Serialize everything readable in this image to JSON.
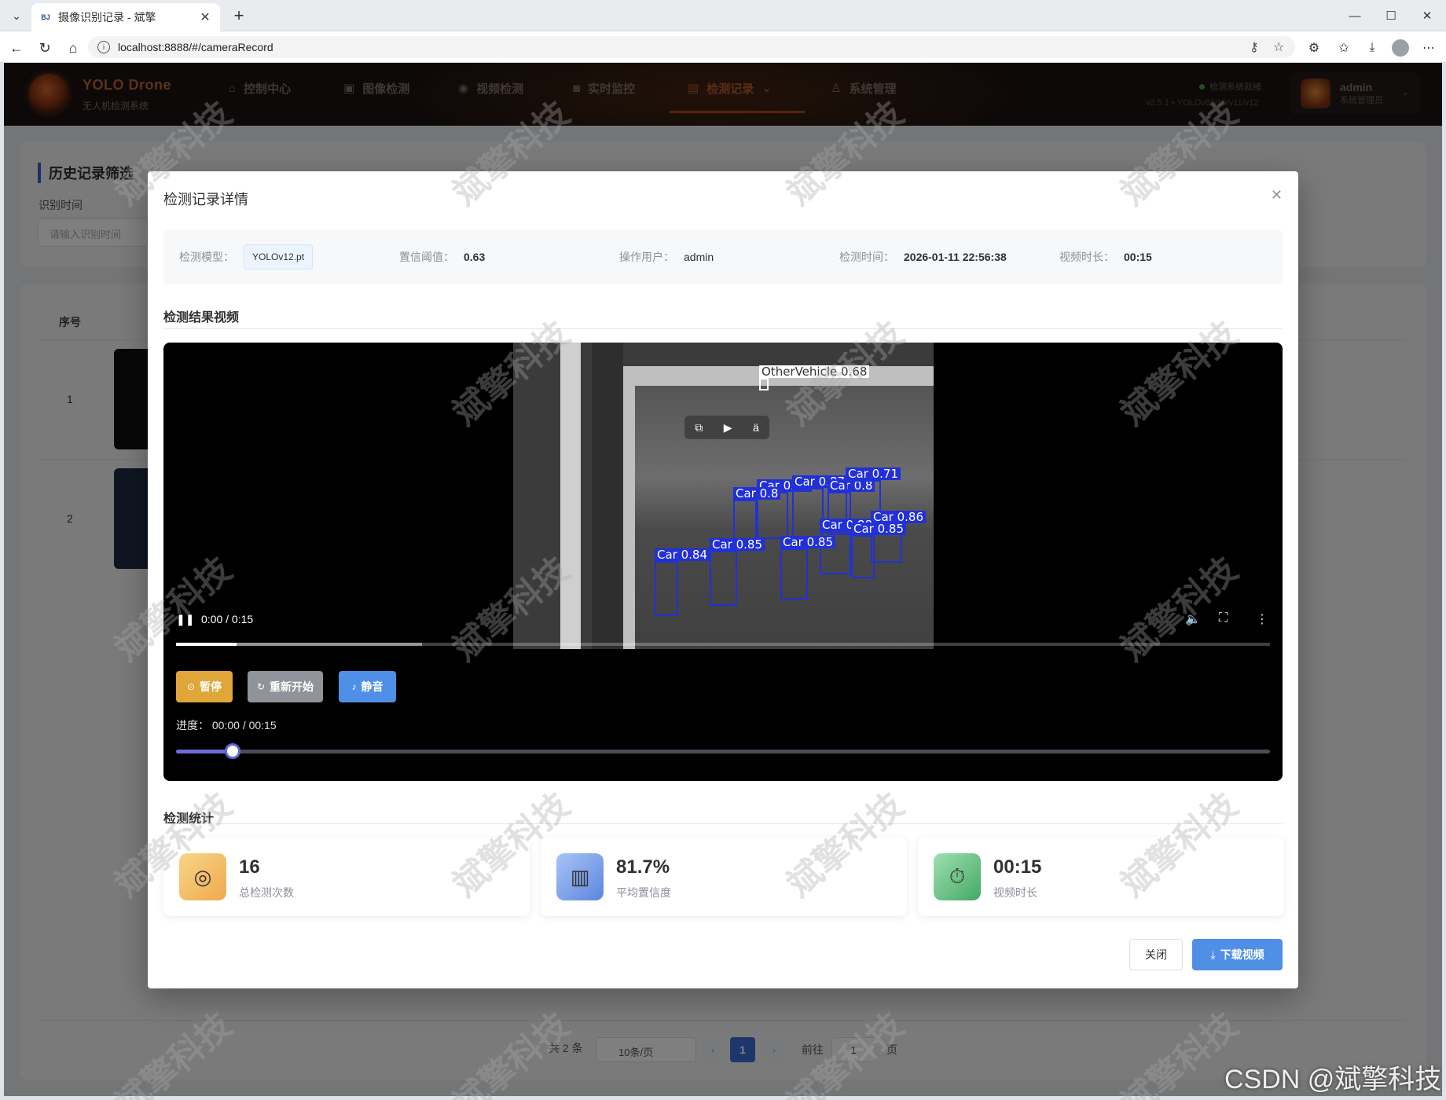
{
  "browser": {
    "tab_title": "摄像识别记录 - 斌擎",
    "favicon_text": "BJ",
    "url": "localhost:8888/#/cameraRecord"
  },
  "header": {
    "app_name": "YOLO Drone",
    "app_sub": "无人机检测系统",
    "nav": [
      {
        "label": "控制中心",
        "icon": "home-icon"
      },
      {
        "label": "图像检测",
        "icon": "image-icon"
      },
      {
        "label": "视频检测",
        "icon": "play-circle-icon"
      },
      {
        "label": "实时监控",
        "icon": "camera-icon"
      },
      {
        "label": "检测记录",
        "icon": "document-icon",
        "active": true
      },
      {
        "label": "系统管理",
        "icon": "user-icon"
      }
    ],
    "status_text": "检测系统就绪",
    "version": "v2.5.1 • YOLOv8/v10/v11/v12",
    "user_name": "admin",
    "user_role": "系统管理员"
  },
  "page": {
    "filter_title": "历史记录筛选",
    "filter_label": "识别时间",
    "filter_placeholder": "请输入识别时间",
    "table_header_seq": "序号",
    "rows": [
      "1",
      "2"
    ],
    "pagination": {
      "total": "共 2 条",
      "page_size": "10条/页",
      "current": "1",
      "goto_prefix": "前往",
      "goto_value": "1",
      "goto_suffix": "页"
    }
  },
  "modal": {
    "title": "检测记录详情",
    "info": {
      "model_label": "检测模型：",
      "model_value": "YOLOv12.pt",
      "conf_label": "置信阈值：",
      "conf_value": "0.63",
      "user_label": "操作用户：",
      "user_value": "admin",
      "time_label": "检测时间：",
      "time_value": "2026-01-11 22:56:38",
      "duration_label": "视频时长：",
      "duration_value": "00:15"
    },
    "video_section_title": "检测结果视频",
    "video": {
      "time_display": "0:00 / 0:15",
      "buffered_fraction": 0.225,
      "played_fraction": 0.055,
      "detections": [
        {
          "label": "OtherVehicle 0.68"
        },
        {
          "label": "Car 0.85"
        },
        {
          "label": "Car 0.87"
        },
        {
          "label": "Car 0.8"
        },
        {
          "label": "Car 0.8"
        },
        {
          "label": "Car 0.71"
        },
        {
          "label": "Car 0.86"
        },
        {
          "label": "Car 0.88"
        },
        {
          "label": "Car 0.85"
        },
        {
          "label": "Car 0.85"
        },
        {
          "label": "Car 0.85"
        },
        {
          "label": "Car 0.84"
        }
      ]
    },
    "controls": {
      "pause_label": "暂停",
      "restart_label": "重新开始",
      "mute_label": "静音",
      "progress_text": "进度：  00:00 / 00:15",
      "progress_fraction": 0.052
    },
    "stats_section_title": "检测统计",
    "stats": [
      {
        "value": "16",
        "label": "总检测次数",
        "icon": "target-icon"
      },
      {
        "value": "81.7%",
        "label": "平均置信度",
        "icon": "bar-chart-icon"
      },
      {
        "value": "00:15",
        "label": "视频时长",
        "icon": "stopwatch-icon"
      }
    ],
    "close_label": "关闭",
    "download_label": "下载视频"
  },
  "watermark": {
    "text": "斌擎科技",
    "csdn": "CSDN @斌擎科技"
  },
  "colors": {
    "accent_blue": "#3b6fd8",
    "pause_orange": "#e0a63a",
    "restart_gray": "#909399",
    "mute_blue": "#4f8fe6",
    "nav_active": "#b45a2c",
    "detection_box": "#2230d8"
  }
}
